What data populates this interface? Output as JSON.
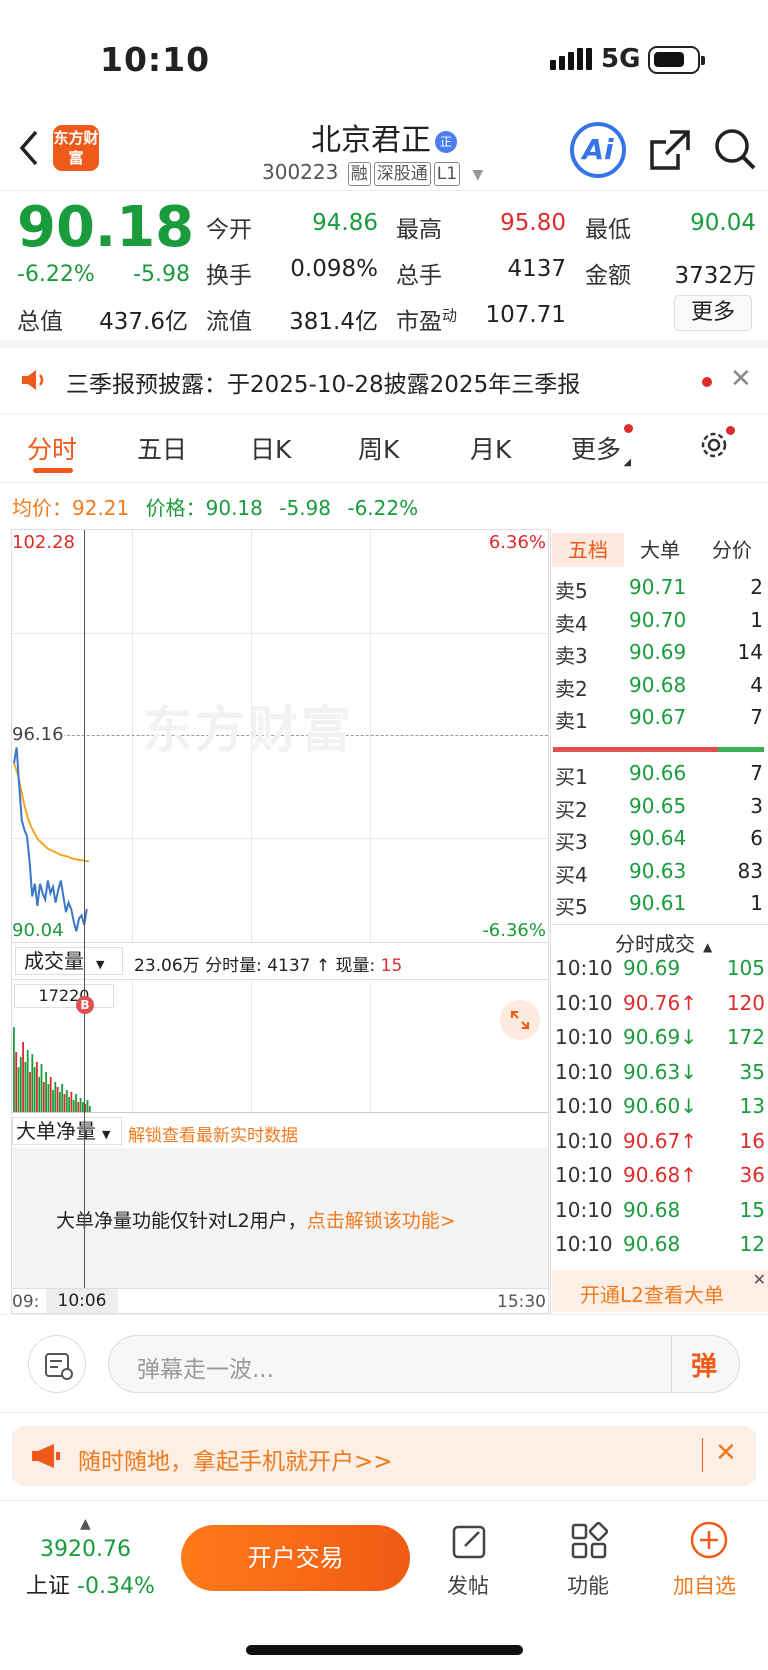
{
  "status": {
    "time": "10:10",
    "network": "5G"
  },
  "header": {
    "logo": "东方财富",
    "name": "北京君正",
    "name_badge": "正",
    "code": "300223",
    "tags": [
      "融",
      "深股通",
      "L1"
    ],
    "ai": "Ai"
  },
  "quote": {
    "price": "90.18",
    "change_pct": "-6.22%",
    "change": "-5.98",
    "open_label": "今开",
    "open": "94.86",
    "high_label": "最高",
    "high": "95.80",
    "low_label": "最低",
    "low": "90.04",
    "turnover_label": "换手",
    "turnover": "0.098%",
    "volume_label": "总手",
    "volume": "4137",
    "amount_label": "金额",
    "amount": "3732万",
    "mktcap_label": "总值",
    "mktcap": "437.6亿",
    "float_label": "流值",
    "float": "381.4亿",
    "pe_label": "市盈",
    "pe_sup": "动",
    "pe": "107.71",
    "more": "更多"
  },
  "notice": {
    "text": "三季报预披露：于2025-10-28披露2025年三季报"
  },
  "tabs": [
    "分时",
    "五日",
    "日K",
    "周K",
    "月K",
    "更多"
  ],
  "avg_line": {
    "avg_label": "均价：",
    "avg": "92.21",
    "price_label": "价格：",
    "price": "90.18",
    "chg": "-5.98",
    "pct": "-6.22%"
  },
  "chart": {
    "y_top": "102.28",
    "y_mid": "96.16",
    "y_bot": "90.04",
    "pct_top": "6.36%",
    "pct_bot": "-6.36%",
    "watermark": "东方财富",
    "vol_label": "成交量",
    "vol_info": "23.06万 分时量: 4137 ↑ 现量: ",
    "vol_now": "15",
    "vol_max": "17220",
    "b_mark": "B",
    "big_label": "大单净量",
    "big_unlock": "解锁查看最新实时数据",
    "big_msg": "大单净量功能仅针对L2用户，",
    "big_link": "点击解锁该功能>",
    "x_start": "09:",
    "x_cursor": "10:06",
    "x_end": "15:30",
    "price_series": [
      95.3,
      95.8,
      94.6,
      93.5,
      93.2,
      93.0,
      92.2,
      91.1,
      91.5,
      90.8,
      91.5,
      91.2,
      91.0,
      91.6,
      91.2,
      91.4,
      90.9,
      91.3,
      91.6,
      91.1,
      90.6,
      90.9,
      90.7,
      90.3,
      90.0,
      90.4,
      90.5,
      90.2,
      90.7
    ],
    "avg_series": [
      95.3,
      95.0,
      94.5,
      94.0,
      93.6,
      93.3,
      93.1,
      92.9,
      92.8,
      92.7,
      92.6,
      92.55,
      92.5,
      92.45,
      92.4,
      92.38,
      92.35,
      92.3,
      92.28,
      92.25,
      92.24,
      92.22,
      92.21
    ],
    "volumes": [
      0.85,
      0.6,
      0.45,
      0.55,
      0.7,
      0.5,
      0.62,
      0.4,
      0.58,
      0.45,
      0.5,
      0.35,
      0.48,
      0.3,
      0.4,
      0.28,
      0.35,
      0.22,
      0.3,
      0.25,
      0.2,
      0.28,
      0.18,
      0.22,
      0.15,
      0.2,
      0.12,
      0.18,
      0.1,
      0.14,
      0.1,
      0.08,
      0.12,
      0.06
    ]
  },
  "panel": {
    "tabs": [
      "五档",
      "大单",
      "分价"
    ],
    "asks": [
      {
        "l": "卖5",
        "p": "90.71",
        "v": "2"
      },
      {
        "l": "卖4",
        "p": "90.70",
        "v": "1"
      },
      {
        "l": "卖3",
        "p": "90.69",
        "v": "14"
      },
      {
        "l": "卖2",
        "p": "90.68",
        "v": "4"
      },
      {
        "l": "卖1",
        "p": "90.67",
        "v": "7"
      }
    ],
    "bids": [
      {
        "l": "买1",
        "p": "90.66",
        "v": "7"
      },
      {
        "l": "买2",
        "p": "90.65",
        "v": "3"
      },
      {
        "l": "买3",
        "p": "90.64",
        "v": "6"
      },
      {
        "l": "买4",
        "p": "90.63",
        "v": "83"
      },
      {
        "l": "买5",
        "p": "90.61",
        "v": "1"
      }
    ],
    "ticks_title": "分时成交",
    "ticks": [
      {
        "t": "10:10",
        "p": "90.69",
        "v": "105"
      },
      {
        "t": "10:10",
        "p": "90.76↑",
        "v": "120"
      },
      {
        "t": "10:10",
        "p": "90.69↓",
        "v": "172"
      },
      {
        "t": "10:10",
        "p": "90.63↓",
        "v": "35"
      },
      {
        "t": "10:10",
        "p": "90.60↓",
        "v": "13"
      },
      {
        "t": "10:10",
        "p": "90.67↑",
        "v": "16"
      },
      {
        "t": "10:10",
        "p": "90.68↑",
        "v": "36"
      },
      {
        "t": "10:10",
        "p": "90.68",
        "v": "15"
      },
      {
        "t": "10:10",
        "p": "90.68",
        "v": "12"
      }
    ],
    "l2": "开通L2查看大单"
  },
  "danmu": {
    "placeholder": "弹幕走一波...",
    "btn": "弹"
  },
  "promo": {
    "text": "随时随地，拿起手机就开户>>"
  },
  "bottom": {
    "index_val": "3920.76",
    "index_name": "上证",
    "index_chg": "-0.34%",
    "trade": "开户交易",
    "post": "发帖",
    "func": "功能",
    "watch": "加自选"
  }
}
